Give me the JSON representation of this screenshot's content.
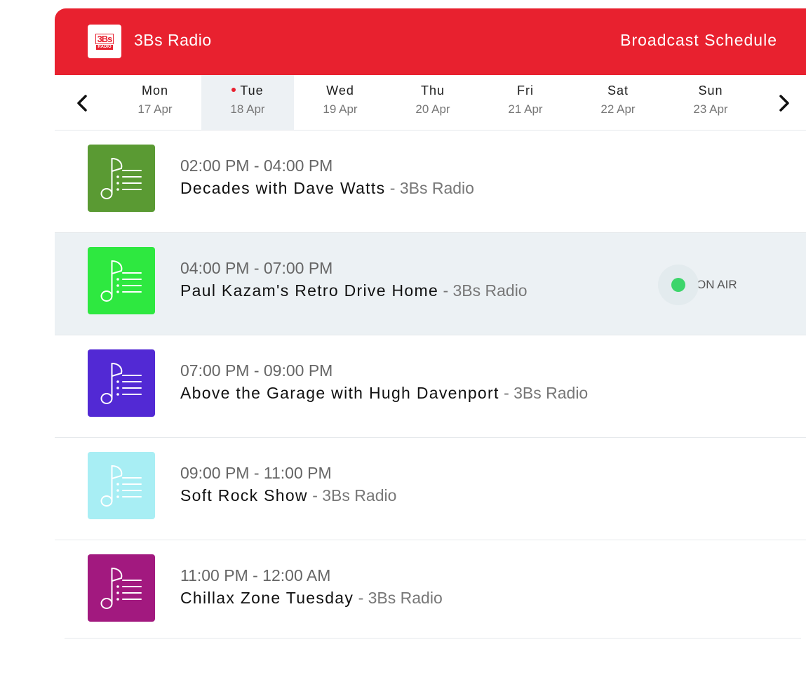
{
  "header": {
    "logo_text": "3Bs",
    "logo_sub": "RADIO",
    "station_name": "3Bs Radio",
    "page_title": "Broadcast Schedule",
    "color": "#e8212f"
  },
  "days": [
    {
      "name": "Mon",
      "date": "17 Apr",
      "active": false
    },
    {
      "name": "Tue",
      "date": "18 Apr",
      "active": true
    },
    {
      "name": "Wed",
      "date": "19 Apr",
      "active": false
    },
    {
      "name": "Thu",
      "date": "20 Apr",
      "active": false
    },
    {
      "name": "Fri",
      "date": "21 Apr",
      "active": false
    },
    {
      "name": "Sat",
      "date": "22 Apr",
      "active": false
    },
    {
      "name": "Sun",
      "date": "23 Apr",
      "active": false
    }
  ],
  "nav": {
    "prev_icon": "chevron-left-icon",
    "next_icon": "chevron-right-icon"
  },
  "shows": [
    {
      "time": "02:00 PM - 04:00 PM",
      "title": "Decades with Dave Watts",
      "station": "- 3Bs Radio",
      "color": "#5a9a33",
      "icon": "music-note-list-icon"
    },
    {
      "time": "04:00 PM - 07:00 PM",
      "title": "Paul Kazam's Retro Drive Home",
      "station": "- 3Bs Radio",
      "color": "#2ee840",
      "icon": "music-note-list-icon",
      "on_air": true
    },
    {
      "time": "07:00 PM - 09:00 PM",
      "title": "Above the Garage with Hugh Davenport",
      "station": "- 3Bs Radio",
      "color": "#5229d4",
      "icon": "music-note-list-icon"
    },
    {
      "time": "09:00 PM - 11:00 PM",
      "title": "Soft Rock Show",
      "station": "- 3Bs Radio",
      "color": "#a8eef4",
      "icon": "music-note-list-icon"
    },
    {
      "time": "11:00 PM - 12:00 AM",
      "title": "Chillax Zone Tuesday",
      "station": "- 3Bs Radio",
      "color": "#a2197f",
      "icon": "music-note-list-icon"
    }
  ],
  "on_air": {
    "label": "ON AIR",
    "color": "#3dd56b"
  }
}
